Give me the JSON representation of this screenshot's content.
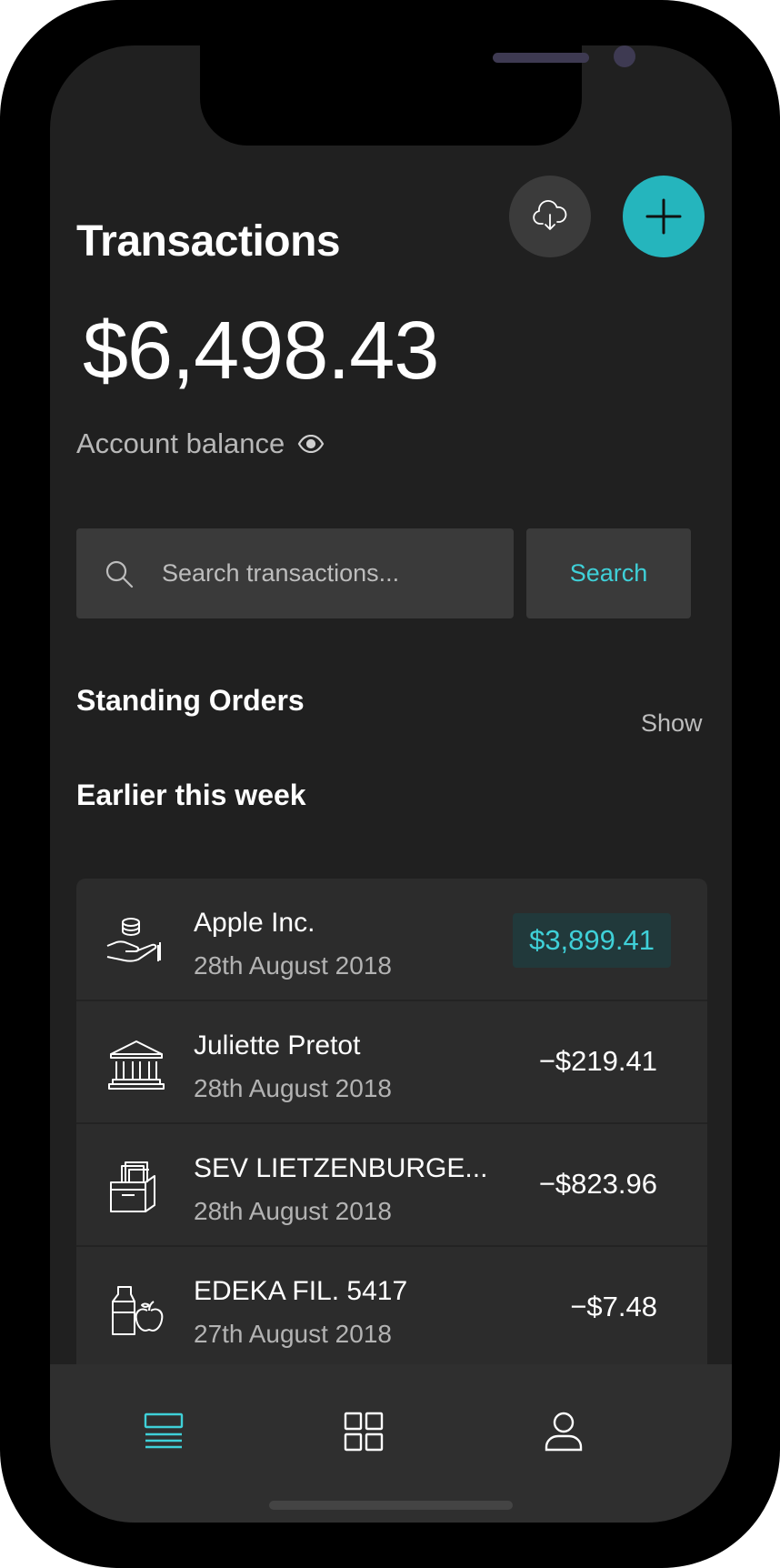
{
  "header": {
    "title": "Transactions",
    "download_icon": "cloud-download-icon",
    "add_icon": "plus-icon"
  },
  "balance": {
    "amount": "$6,498.43",
    "label": "Account balance",
    "visibility_icon": "eye-icon"
  },
  "search": {
    "placeholder": "Search transactions...",
    "button_label": "Search",
    "icon": "search-icon"
  },
  "standing_orders": {
    "title": "Standing Orders",
    "action_label": "Show"
  },
  "recent": {
    "title": "Earlier this week",
    "transactions": [
      {
        "name": "Apple Inc.",
        "date": "28th August 2018",
        "amount": "$3,899.41",
        "icon": "hand-coins-icon"
      },
      {
        "name": "Juliette Pretot",
        "date": "28th August 2018",
        "amount": "−$219.41",
        "icon": "bank-icon"
      },
      {
        "name": "SEV LIETZENBURGE...",
        "date": "28th August 2018",
        "amount": "−$823.96",
        "icon": "box-icon"
      },
      {
        "name": "EDEKA FIL. 5417",
        "date": "27th August 2018",
        "amount": "−$7.48",
        "icon": "groceries-icon"
      }
    ]
  },
  "tabbar": {
    "items": [
      {
        "icon": "list-icon",
        "active": true
      },
      {
        "icon": "grid-icon",
        "active": false
      },
      {
        "icon": "user-icon",
        "active": false
      }
    ]
  },
  "colors": {
    "accent": "#25b5bd",
    "accent_text": "#3fd0d8",
    "background": "#202020",
    "card": "#2c2c2c"
  }
}
